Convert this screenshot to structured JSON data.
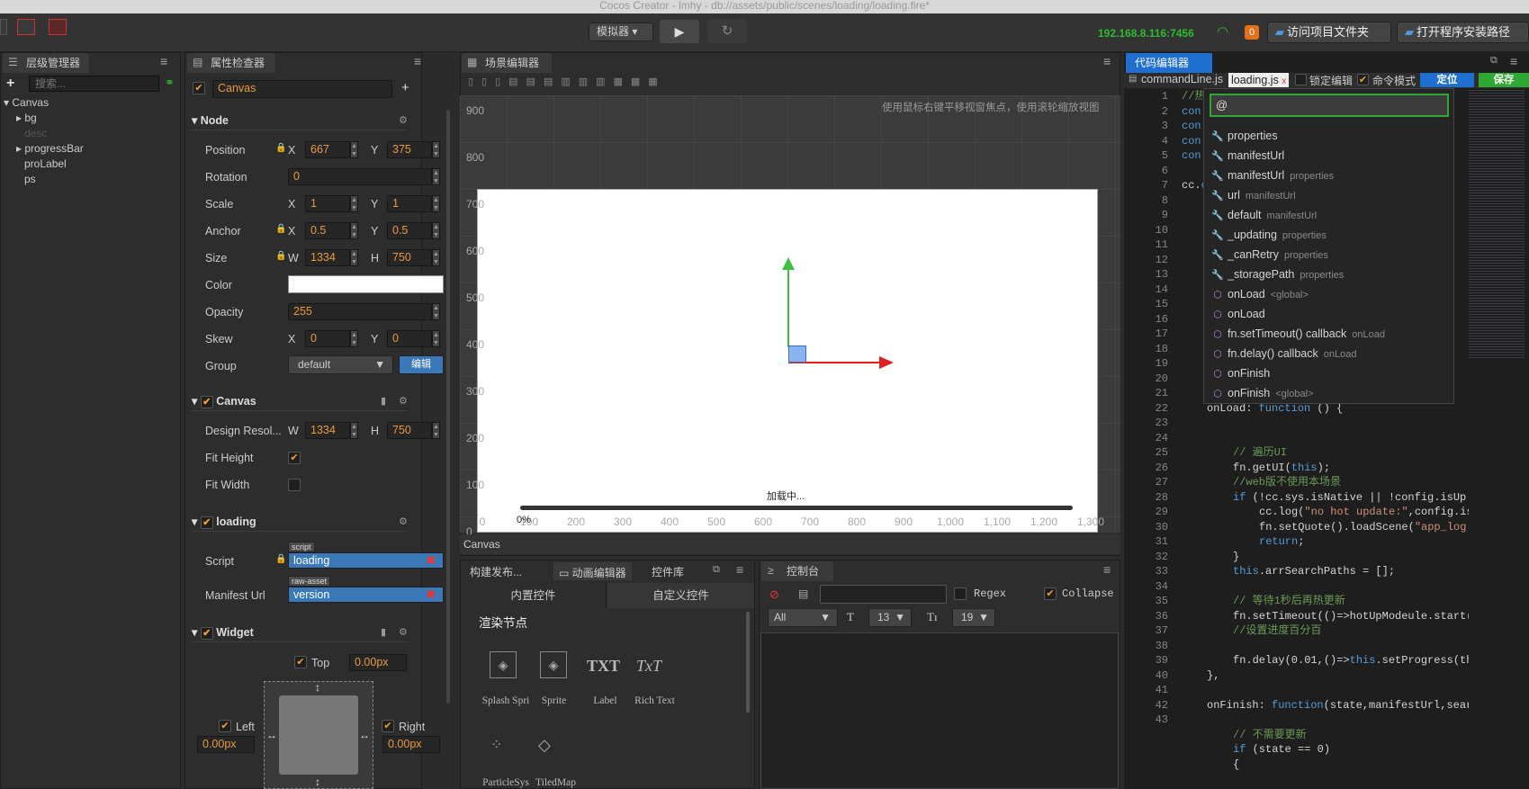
{
  "window_title": "Cocos Creator - lmhy - db://assets/public/scenes/loading/loading.fire*",
  "toolbar": {
    "simulator_label": "模拟器",
    "ip": "192.168.8.116:7456",
    "notification_count": "0",
    "open_project_folder": "访问项目文件夹",
    "open_install_path": "打开程序安装路径"
  },
  "hierarchy": {
    "tab": "层级管理器",
    "search_placeholder": "搜索...",
    "root": "Canvas",
    "nodes": [
      "bg",
      "desc",
      "progressBar",
      "proLabel",
      "ps"
    ]
  },
  "inspector": {
    "tab": "属性检查器",
    "node_name": "Canvas",
    "node_section": "Node",
    "position_label": "Position",
    "pos_x": "667",
    "pos_y": "375",
    "rotation_label": "Rotation",
    "rotation": "0",
    "scale_label": "Scale",
    "scale_x": "1",
    "scale_y": "1",
    "anchor_label": "Anchor",
    "anchor_x": "0.5",
    "anchor_y": "0.5",
    "size_label": "Size",
    "size_w": "1334",
    "size_h": "750",
    "color_label": "Color",
    "opacity_label": "Opacity",
    "opacity": "255",
    "skew_label": "Skew",
    "skew_x": "0",
    "skew_y": "0",
    "group_label": "Group",
    "group_value": "default",
    "group_edit": "编辑",
    "canvas_section": "Canvas",
    "design_res_label": "Design Resol...",
    "design_w": "1334",
    "design_h": "750",
    "fit_height_label": "Fit Height",
    "fit_width_label": "Fit Width",
    "loading_section": "loading",
    "script_label": "Script",
    "script_tag": "script",
    "script_value": "loading",
    "manifest_label": "Manifest Url",
    "manifest_tag": "raw-asset",
    "manifest_value": "version",
    "widget_section": "Widget",
    "top_label": "Top",
    "top_value": "0.00px",
    "left_label": "Left",
    "left_value": "0.00px",
    "right_label": "Right",
    "right_value": "0.00px",
    "x": "X",
    "y": "Y",
    "w": "W",
    "h": "H"
  },
  "scene": {
    "tab": "场景编辑器",
    "hint": "使用鼠标右键平移视窗焦点，使用滚轮缩放视图",
    "y_ticks": [
      "900",
      "800",
      "700",
      "600",
      "500",
      "400",
      "300",
      "200",
      "100",
      "0"
    ],
    "x_ticks": [
      "0",
      "100",
      "200",
      "300",
      "400",
      "500",
      "600",
      "700",
      "800",
      "900",
      "1,000",
      "1,100",
      "1,200",
      "1,300"
    ],
    "loading_text": "加载中...",
    "progress_text": "0%",
    "status_path": "Canvas"
  },
  "bottom_left": {
    "tabs": [
      "构建发布...",
      "动画编辑器",
      "控件库"
    ],
    "subtabs": [
      "内置控件",
      "自定义控件"
    ],
    "section": "渲染节点",
    "widgets": [
      "Splash Spri",
      "Sprite",
      "Label",
      "Rich Text",
      "ParticleSys",
      "TiledMap"
    ]
  },
  "console": {
    "tab": "控制台",
    "regex": "Regex",
    "collapse": "Collapse",
    "filter": "All",
    "font_size": "13",
    "line_height": "19"
  },
  "code_editor": {
    "tab": "代码编辑器",
    "files": [
      "commandLine.js",
      "loading.js"
    ],
    "lock_label": "锁定编辑",
    "cmd_mode": "命令模式",
    "locate": "定位",
    "save": "保存",
    "search_value": "@",
    "line_numbers": [
      "1",
      "2",
      "3",
      "4",
      "5",
      "6",
      "7",
      "8",
      "9",
      "10",
      "11",
      "12",
      "13",
      "14",
      "15",
      "16",
      "17",
      "18",
      "19",
      "20",
      "21",
      "22",
      "23",
      "24",
      "25",
      "26",
      "27",
      "28",
      "29",
      "30",
      "31",
      "32",
      "33",
      "34",
      "35",
      "36",
      "37",
      "38",
      "39",
      "40",
      "41",
      "42",
      "43"
    ],
    "autocomplete": [
      {
        "icon": "wrench",
        "name": "properties",
        "sub": ""
      },
      {
        "icon": "wrench",
        "name": "manifestUrl",
        "sub": ""
      },
      {
        "icon": "wrench",
        "name": "manifestUrl",
        "sub": "properties"
      },
      {
        "icon": "wrench",
        "name": "url",
        "sub": "manifestUrl"
      },
      {
        "icon": "wrench",
        "name": "default",
        "sub": "manifestUrl"
      },
      {
        "icon": "wrench",
        "name": "_updating",
        "sub": "properties"
      },
      {
        "icon": "wrench",
        "name": "_canRetry",
        "sub": "properties"
      },
      {
        "icon": "wrench",
        "name": "_storagePath",
        "sub": "properties"
      },
      {
        "icon": "cube",
        "name": "onLoad",
        "sub": "<global>"
      },
      {
        "icon": "cube",
        "name": "onLoad",
        "sub": ""
      },
      {
        "icon": "cube",
        "name": "fn.setTimeout() callback",
        "sub": "onLoad"
      },
      {
        "icon": "cube",
        "name": "fn.delay() callback",
        "sub": "onLoad"
      },
      {
        "icon": "cube",
        "name": "onFinish",
        "sub": ""
      },
      {
        "icon": "cube",
        "name": "onFinish",
        "sub": "<global>"
      }
    ]
  },
  "colors": {
    "accent_blue": "#3a78b8",
    "ip_green": "#2fbb2f",
    "orange": "#e0701a",
    "input_text": "#e89a3c",
    "axis_green": "#3fbf3f",
    "axis_red": "#e02020"
  }
}
